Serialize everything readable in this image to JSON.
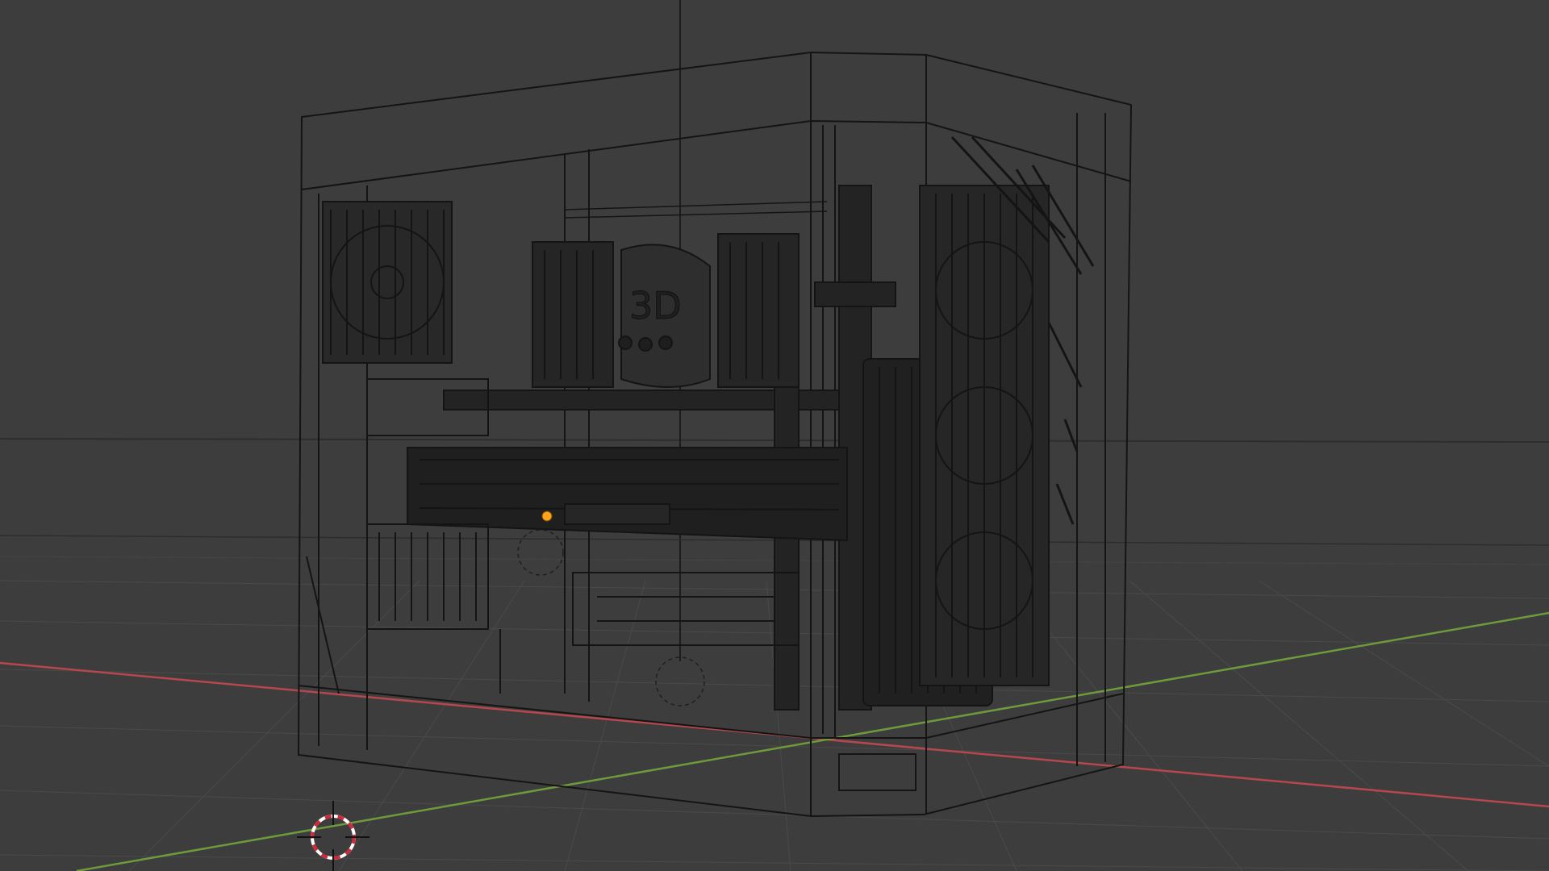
{
  "viewport": {
    "background": "#3d3d3d",
    "grid_color": "#474747",
    "x_axis_color": "#b5474f",
    "y_axis_color": "#6f9a3c",
    "wire_color": "#111111",
    "selected_origin_color": "#ffa21c"
  },
  "model": {
    "fan_hub_text": "3D"
  },
  "icons": {
    "cursor": "3d-cursor-icon",
    "origin": "object-origin-icon"
  }
}
